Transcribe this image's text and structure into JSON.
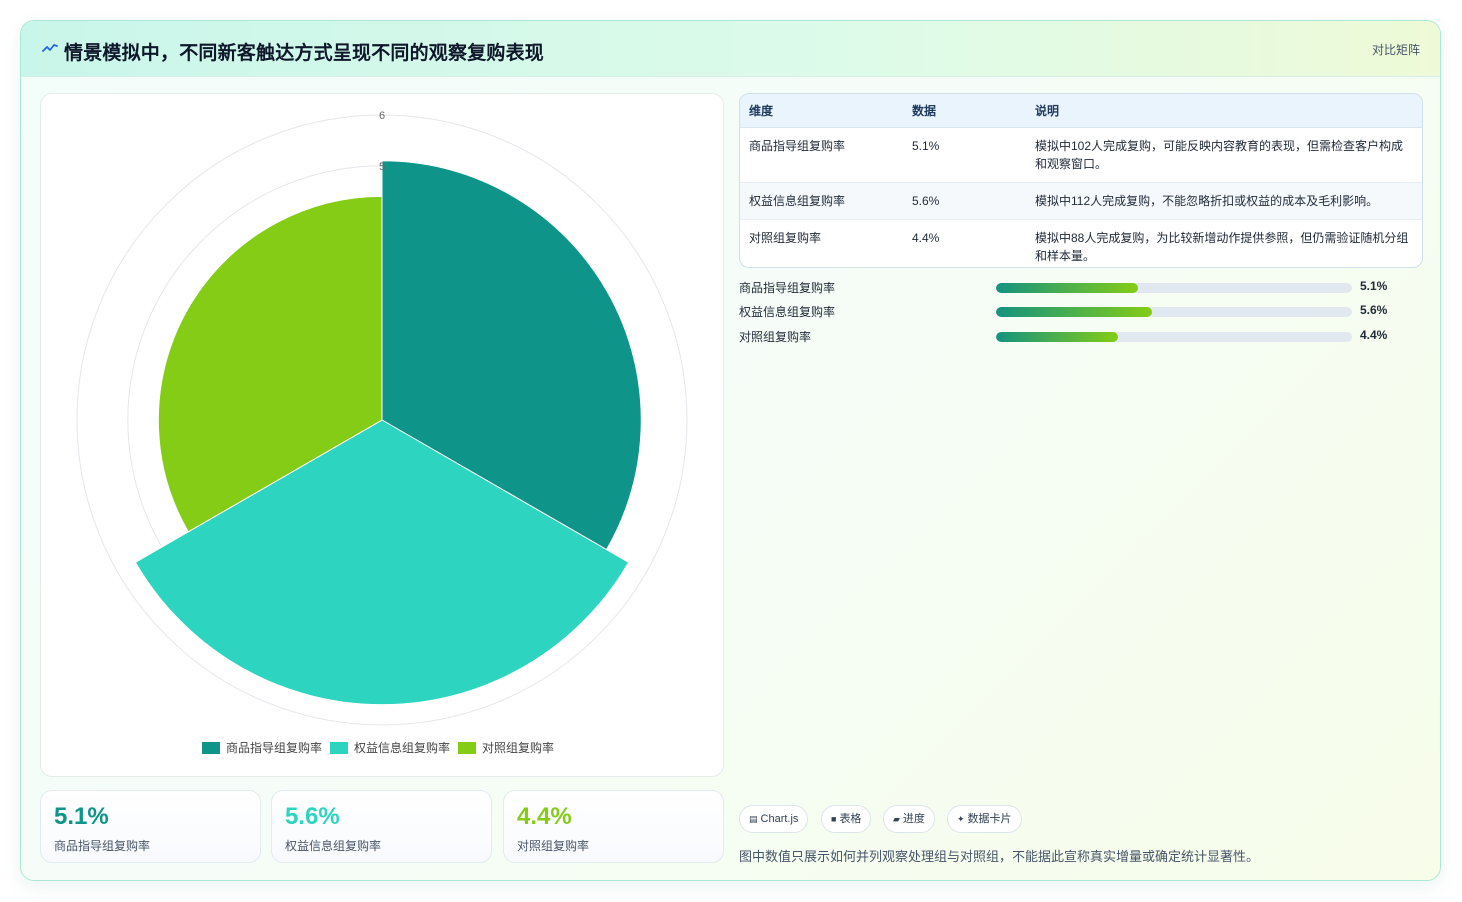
{
  "header": {
    "title": "情景模拟中，不同新客触达方式呈现不同的观察复购表现",
    "tag": "对比矩阵",
    "icon": "trend-line-icon"
  },
  "chart_data": {
    "type": "polarArea",
    "categories": [
      "商品指导组复购率",
      "权益信息组复购率",
      "对照组复购率"
    ],
    "values": [
      5.1,
      5.6,
      4.4
    ],
    "colors": [
      "#0e9488",
      "#2dd4bf",
      "#84cc16"
    ],
    "r_ticks": [
      "5",
      "6"
    ],
    "r_max": 6,
    "legend_position": "bottom"
  },
  "stats": [
    {
      "value": "5.1%",
      "label": "商品指导组复购率",
      "color": "#0e9488"
    },
    {
      "value": "5.6%",
      "label": "权益信息组复购率",
      "color": "#2dd4bf"
    },
    {
      "value": "4.4%",
      "label": "对照组复购率",
      "color": "#84cc16"
    }
  ],
  "table": {
    "headers": [
      "维度",
      "数据",
      "说明"
    ],
    "rows": [
      {
        "dim": "商品指导组复购率",
        "data": "5.1%",
        "desc": "模拟中102人完成复购，可能反映内容教育的表现，但需检查客户构成和观察窗口。"
      },
      {
        "dim": "权益信息组复购率",
        "data": "5.6%",
        "desc": "模拟中112人完成复购，不能忽略折扣或权益的成本及毛利影响。"
      },
      {
        "dim": "对照组复购率",
        "data": "4.4%",
        "desc": "模拟中88人完成复购，为比较新增动作提供参照，但仍需验证随机分组和样本量。"
      }
    ]
  },
  "bars": [
    {
      "label": "商品指导组复购率",
      "value": "5.1%",
      "fraction": 0.398
    },
    {
      "label": "权益信息组复购率",
      "value": "5.6%",
      "fraction": 0.437
    },
    {
      "label": "对照组复购率",
      "value": "4.4%",
      "fraction": 0.343
    }
  ],
  "chips": [
    {
      "icon": "chart-icon",
      "glyph": "▤",
      "label": "Chart.js"
    },
    {
      "icon": "table-icon",
      "glyph": "■",
      "label": "表格"
    },
    {
      "icon": "progress-icon",
      "glyph": "▰",
      "label": "进度"
    },
    {
      "icon": "card-icon",
      "glyph": "✦",
      "label": "数据卡片"
    }
  ],
  "footnote": "图中数值只展示如何并列观察处理组与对照组，不能据此宣称真实增量或确定统计显著性。"
}
